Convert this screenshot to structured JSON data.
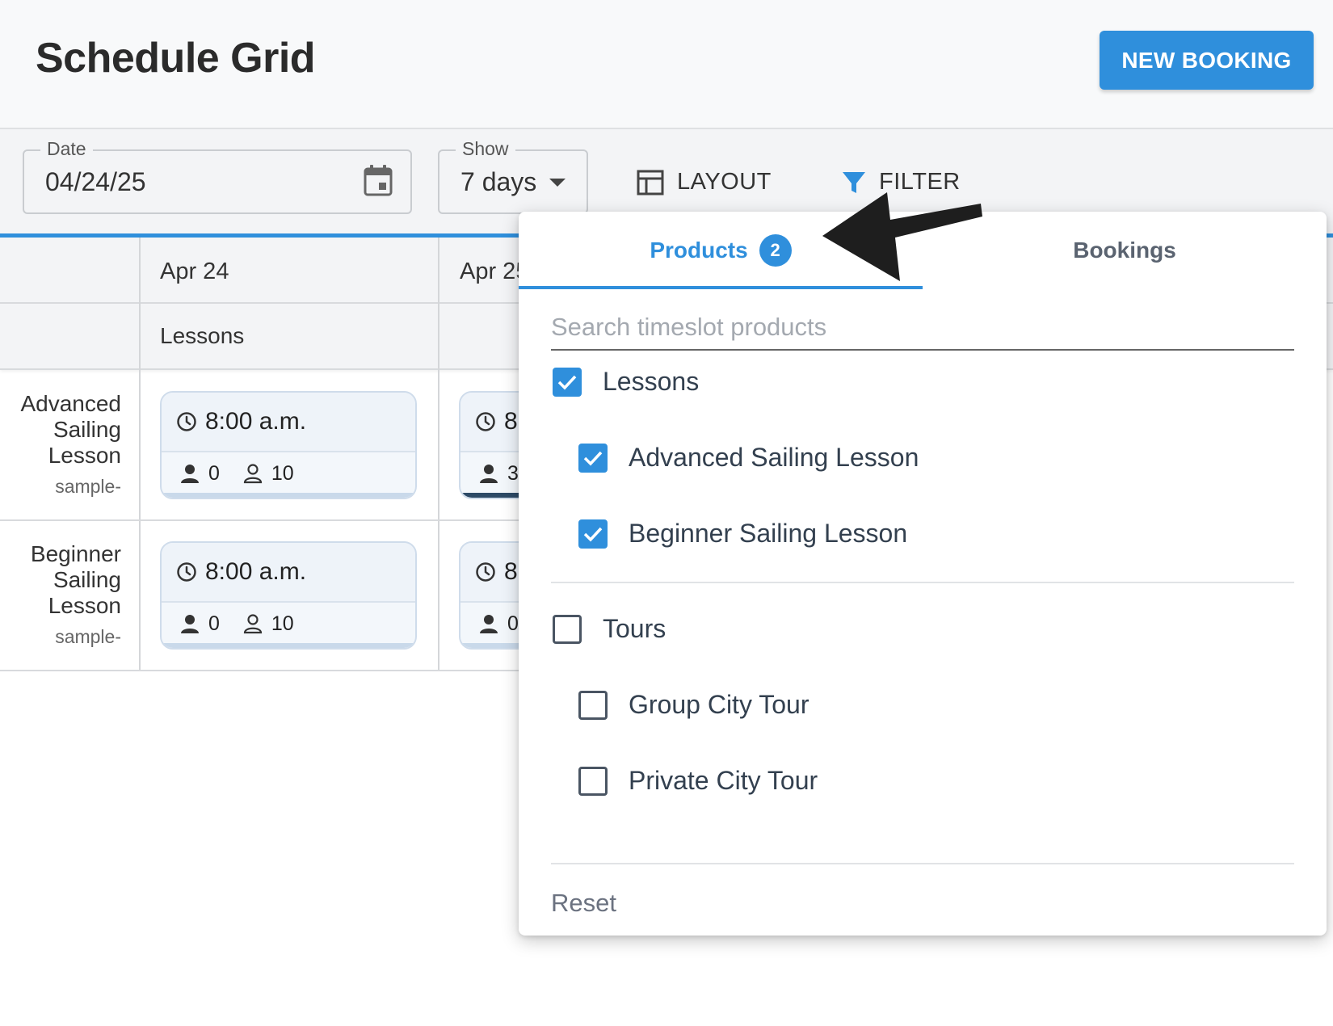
{
  "header": {
    "title": "Schedule Grid",
    "new_booking_label": "NEW BOOKING",
    "accent_color": "#2f8fdc"
  },
  "toolbar": {
    "date": {
      "legend": "Date",
      "value": "04/24/25",
      "icon": "calendar-icon"
    },
    "show": {
      "legend": "Show",
      "value": "7 days",
      "icon": "chevron-down-icon"
    },
    "layout_label": "LAYOUT",
    "filter_label": "FILTER"
  },
  "grid": {
    "days": [
      "Apr 24",
      "Apr 25"
    ],
    "group": "Lessons",
    "rows": [
      {
        "name_lines": [
          "Advanced",
          "Sailing",
          "Lesson"
        ],
        "sub": "sample-",
        "slots": [
          {
            "time": "8:00 a.m.",
            "booked": "0",
            "capacity": "10"
          },
          {
            "time": "8",
            "booked": "3"
          }
        ]
      },
      {
        "name_lines": [
          "Beginner",
          "Sailing",
          "Lesson"
        ],
        "sub": "sample-",
        "slots": [
          {
            "time": "8:00 a.m.",
            "booked": "0",
            "capacity": "10"
          },
          {
            "time": "8",
            "booked": "0"
          }
        ]
      }
    ]
  },
  "filter_popover": {
    "tabs": [
      {
        "label": "Products",
        "badge": "2",
        "active": true
      },
      {
        "label": "Bookings",
        "active": false
      }
    ],
    "search_placeholder": "Search timeslot products",
    "groups": [
      {
        "label": "Lessons",
        "checked": true,
        "items": [
          {
            "label": "Advanced Sailing Lesson",
            "checked": true
          },
          {
            "label": "Beginner Sailing Lesson",
            "checked": true
          }
        ]
      },
      {
        "label": "Tours",
        "checked": false,
        "items": [
          {
            "label": "Group City Tour",
            "checked": false
          },
          {
            "label": "Private City Tour",
            "checked": false
          }
        ]
      }
    ],
    "reset_label": "Reset"
  }
}
